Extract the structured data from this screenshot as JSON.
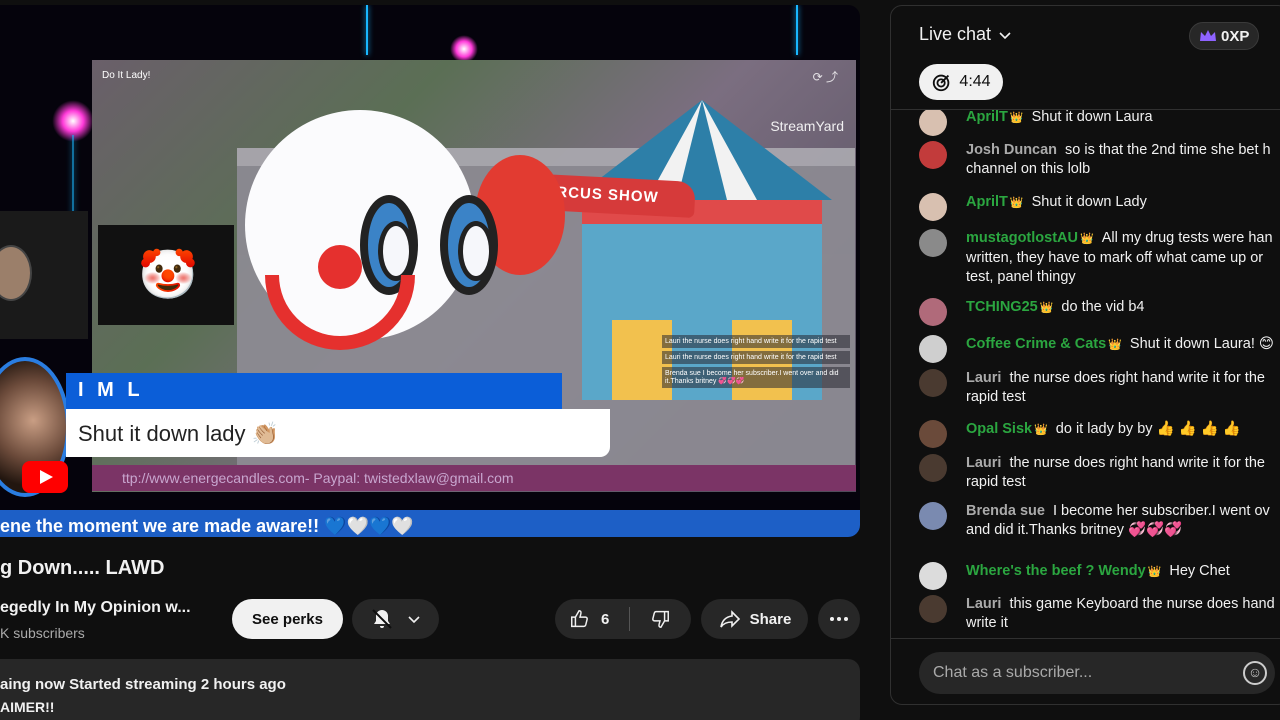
{
  "video": {
    "frame_title": "Do It Lady!",
    "streamyard_label": "StreamYard",
    "name_tag": "I M L",
    "comment": "Shut it down lady 👏🏼",
    "ticker": "ttp://www.energecandles.com- Paypal: twistedxlaw@gmail.com",
    "tent_banner": "CIRCUS SHOW",
    "blue_banner": "ene the moment we are made aware!! 💙🤍💙🤍",
    "mini_chat": [
      "Lauri the nurse does right hand write it for the rapid test",
      "Lauri the nurse does right hand write it for the rapid test",
      "Brenda sue I become her subscriber.I went over and did it.Thanks britney 💞💞💞"
    ]
  },
  "meta": {
    "title": "g Down..... LAWD",
    "channel": "egedly In My Opinion w...",
    "subscribers": "K subscribers",
    "see_perks": "See perks",
    "likes": "6",
    "share": "Share",
    "status": "aing now  Started streaming 2 hours ago",
    "disclaimer": "AIMER!!"
  },
  "chat": {
    "title": "Live chat",
    "xp": "0XP",
    "timer": "4:44",
    "input_placeholder": "Chat as a subscriber...",
    "messages": [
      {
        "author": "AprilT",
        "badge": "👑",
        "text": "Shut it down Laura",
        "lines": 1
      },
      {
        "author": "Josh Duncan",
        "badge": "",
        "text": "so is that the 2nd time she bet h",
        "text2": "channel on this lolb",
        "lines": 2,
        "plain": true
      },
      {
        "author": "AprilT",
        "badge": "👑",
        "text": "Shut it down Lady",
        "lines": 1
      },
      {
        "author": "mustagotlostAU",
        "badge": "👑",
        "text": "All my drug tests were han",
        "text2": "written, they have to mark off what came up or",
        "text3": "test, panel thingy",
        "lines": 3
      },
      {
        "author": "TCHING25",
        "badge": "👑",
        "text": "do the vid b4",
        "lines": 1
      },
      {
        "author": "Coffee Crime & Cats",
        "badge": "👑",
        "text": "Shut it down Laura! 😊",
        "lines": 1
      },
      {
        "author": "Lauri",
        "badge": "",
        "text": "the nurse does right hand write it for the",
        "text2": "rapid test",
        "lines": 2,
        "plain": true
      },
      {
        "author": "Opal Sisk",
        "badge": "👑",
        "text": "do it lady by by 👍 👍 👍 👍",
        "lines": 1
      },
      {
        "author": "Lauri",
        "badge": "",
        "text": "the nurse does right hand write it for the",
        "text2": "rapid test",
        "lines": 2,
        "plain": true
      },
      {
        "author": "Brenda sue",
        "badge": "",
        "text": "I become her subscriber.I went ov",
        "text2": "and did it.Thanks britney 💞💞💞",
        "lines": 2,
        "plain": true
      },
      {
        "author": "Where's the beef ? Wendy",
        "badge": "👑",
        "text": "Hey Chet",
        "lines": 1
      },
      {
        "author": "Lauri",
        "badge": "",
        "text": "this game Keyboard the nurse does hand",
        "text2": "write it",
        "lines": 2,
        "plain": true
      }
    ]
  }
}
